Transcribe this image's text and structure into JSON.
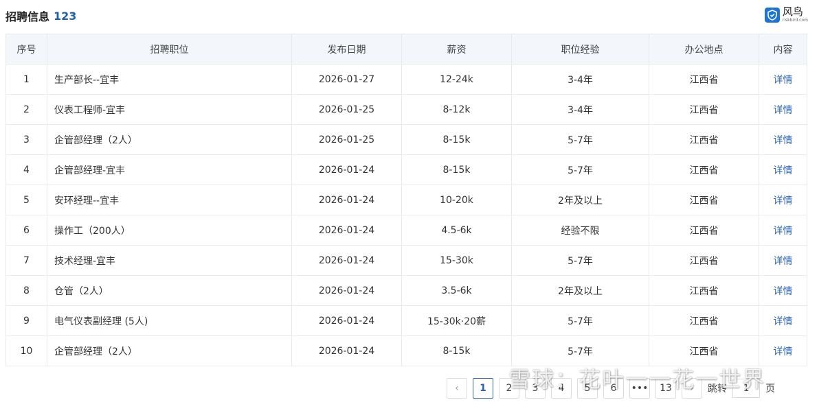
{
  "header": {
    "title": "招聘信息",
    "count": "123"
  },
  "brand": {
    "name": "风鸟",
    "sub": "riskbird.com",
    "color": "#1e73d8"
  },
  "table": {
    "columns": [
      "序号",
      "招聘职位",
      "发布日期",
      "薪资",
      "职位经验",
      "办公地点",
      "内容"
    ],
    "rows": [
      {
        "index": "1",
        "position": "生产部长--宜丰",
        "date": "2026-01-27",
        "salary": "12-24k",
        "experience": "3-4年",
        "location": "江西省",
        "detail": "详情"
      },
      {
        "index": "2",
        "position": "仪表工程师-宜丰",
        "date": "2026-01-25",
        "salary": "8-12k",
        "experience": "3-4年",
        "location": "江西省",
        "detail": "详情"
      },
      {
        "index": "3",
        "position": "企管部经理（2人）",
        "date": "2026-01-25",
        "salary": "8-15k",
        "experience": "5-7年",
        "location": "江西省",
        "detail": "详情"
      },
      {
        "index": "4",
        "position": "企管部经理-宜丰",
        "date": "2026-01-24",
        "salary": "8-15k",
        "experience": "5-7年",
        "location": "江西省",
        "detail": "详情"
      },
      {
        "index": "5",
        "position": "安环经理--宜丰",
        "date": "2026-01-24",
        "salary": "10-20k",
        "experience": "2年及以上",
        "location": "江西省",
        "detail": "详情"
      },
      {
        "index": "6",
        "position": "操作工（200人）",
        "date": "2026-01-24",
        "salary": "4.5-6k",
        "experience": "经验不限",
        "location": "江西省",
        "detail": "详情"
      },
      {
        "index": "7",
        "position": "技术经理-宜丰",
        "date": "2026-01-24",
        "salary": "15-30k",
        "experience": "5-7年",
        "location": "江西省",
        "detail": "详情"
      },
      {
        "index": "8",
        "position": "仓管（2人）",
        "date": "2026-01-24",
        "salary": "3.5-6k",
        "experience": "2年及以上",
        "location": "江西省",
        "detail": "详情"
      },
      {
        "index": "9",
        "position": "电气仪表副经理 (5人)",
        "date": "2026-01-24",
        "salary": "15-30k·20薪",
        "experience": "5-7年",
        "location": "江西省",
        "detail": "详情"
      },
      {
        "index": "10",
        "position": "企管部经理（2人）",
        "date": "2026-01-24",
        "salary": "8-15k",
        "experience": "5-7年",
        "location": "江西省",
        "detail": "详情"
      }
    ]
  },
  "pagination": {
    "prev": "‹",
    "pages": [
      "1",
      "2",
      "3",
      "4",
      "5",
      "6"
    ],
    "ellipsis": "•••",
    "last": "13",
    "next": "›",
    "current": "1",
    "jump_label": "跳转",
    "jump_value": "1",
    "unit": "页"
  },
  "watermark": {
    "text": "雪球：花叶一一花一世界"
  },
  "colors": {
    "accent": "#2a63b5",
    "header_bg": "#f3f6fb",
    "border": "#e8eaee"
  }
}
